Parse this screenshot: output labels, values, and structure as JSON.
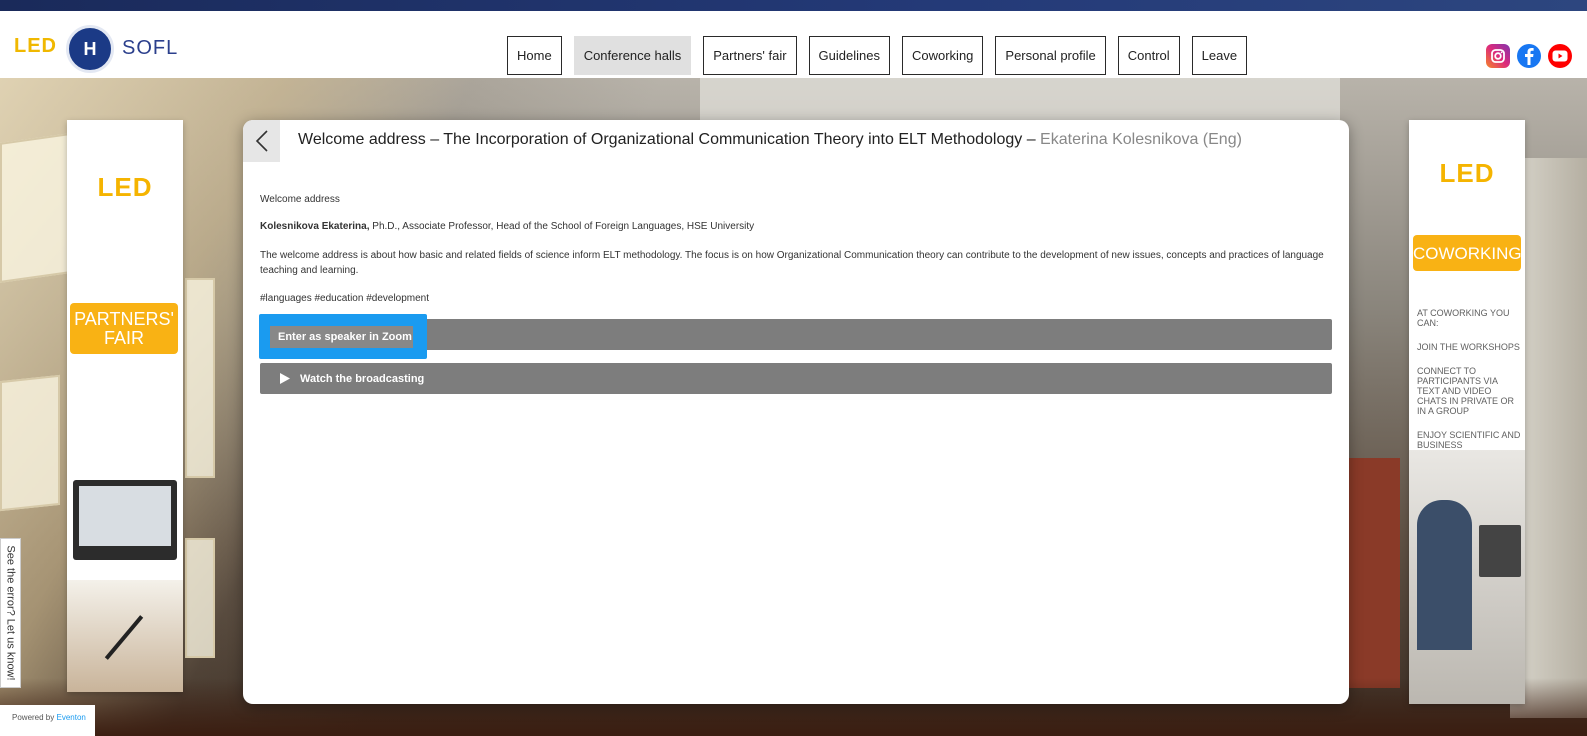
{
  "header": {
    "logo_led": "LED",
    "logo_hse": "Н",
    "logo_sofl": "SOFL",
    "nav": [
      {
        "label": "Home",
        "active": false
      },
      {
        "label": "Conference halls",
        "active": true
      },
      {
        "label": "Partners' fair",
        "active": false
      },
      {
        "label": "Guidelines",
        "active": false
      },
      {
        "label": "Coworking",
        "active": false
      },
      {
        "label": "Personal profile",
        "active": false
      },
      {
        "label": "Control",
        "active": false
      },
      {
        "label": "Leave",
        "active": false
      }
    ],
    "social": [
      {
        "name": "instagram-icon",
        "color": "#e1306c"
      },
      {
        "name": "facebook-icon",
        "color": "#1877f2"
      },
      {
        "name": "youtube-icon",
        "color": "#ff0000"
      }
    ]
  },
  "left_banner": {
    "logo": "LED",
    "button": "PARTNERS' FAIR"
  },
  "right_banner": {
    "logo": "LED",
    "button": "COWORKING",
    "lines": [
      "AT COWORKING YOU CAN:",
      "JOIN THE WORKSHOPS",
      "CONNECT TO PARTICIPANTS VIA TEXT AND VIDEO CHATS IN PRIVATE OR IN A GROUP",
      "ENJOY SCIENTIFIC AND BUSINESS CONNECTING AND COLLABORATING"
    ]
  },
  "modal": {
    "title_main": "Welcome address – The Incorporation of Organizational Communication Theory into ELT Methodology –",
    "title_speaker": "Ekaterina Kolesnikova (Eng)",
    "section_label": "Welcome address",
    "speaker_name": "Kolesnikova Ekaterina,",
    "speaker_info": "Ph.D., Associate Professor, Head of the School of Foreign Languages, HSE University",
    "description": "The welcome address is about how basic and related fields of science inform ELT methodology. The focus is on how Organizational Communication theory can contribute to the development of new issues, concepts and practices of language teaching and learning.",
    "tags": "#languages #education #development",
    "zoom_button": "Enter as speaker in Zoom",
    "watch_button": "Watch the broadcasting"
  },
  "feedback": "See the error? Let us know!",
  "powered_prefix": "Powered by",
  "powered_brand": "Eventon"
}
